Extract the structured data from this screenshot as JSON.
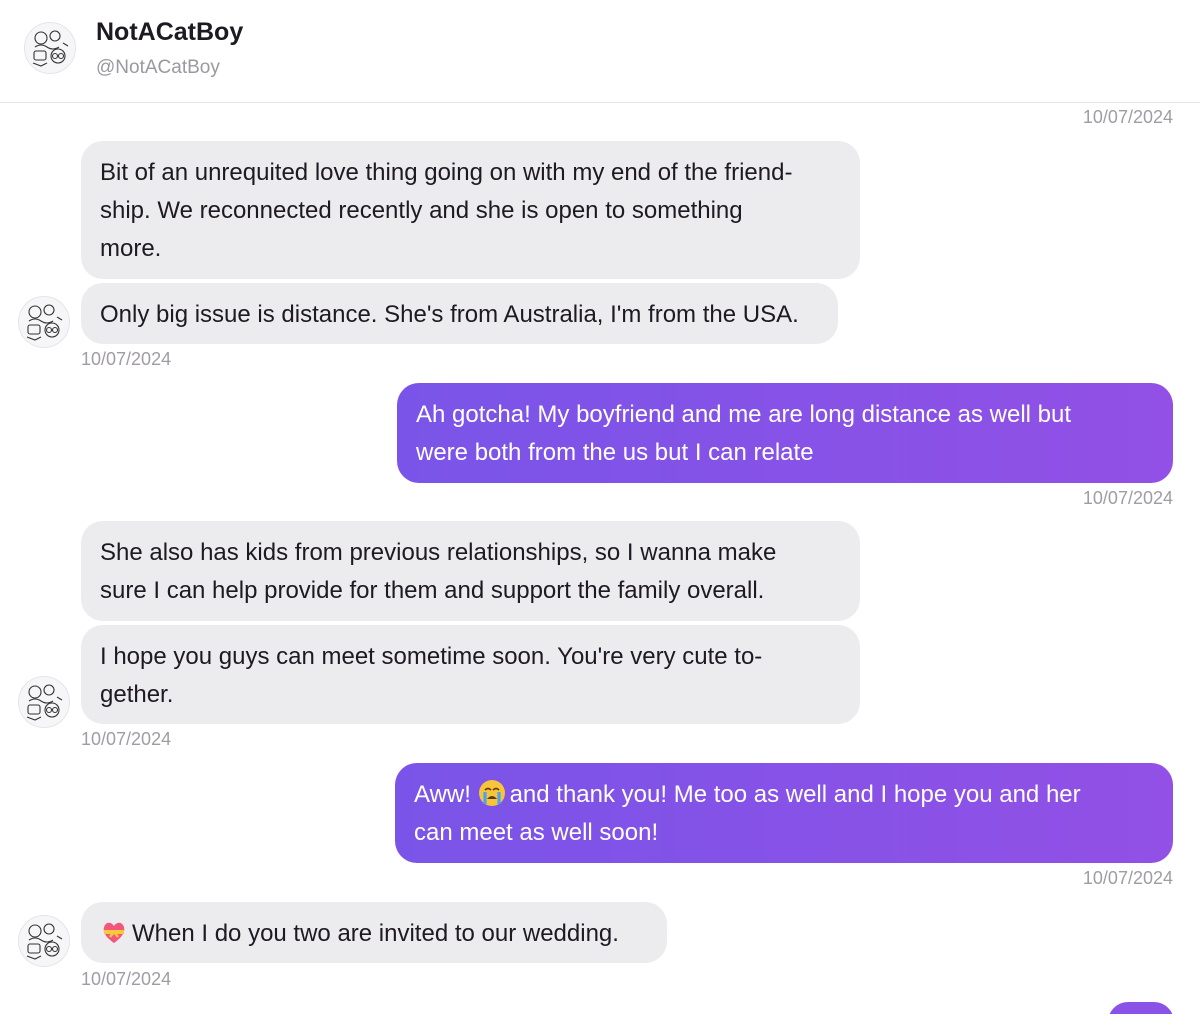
{
  "header": {
    "name": "NotACatBoy",
    "handle": "@NotACatBoy"
  },
  "messages": {
    "m1_time": "10/07/2024",
    "m1_a": "Bit of an unrequited love thing going on with my end of the friend-ship. We reconnected recently and she is open to something more.",
    "m1_a_lines": [
      "Bit of an unrequited love thing going on with my end of the friend-",
      "ship. We reconnected recently and she is open to something",
      "more."
    ],
    "m1_b": "Only big issue is distance. She's from Australia, I'm from the USA.",
    "m1_stamp": "10/07/2024",
    "m2_lines": [
      "Ah gotcha! My boyfriend and me are long distance as well but",
      "were both from the us but I can relate"
    ],
    "m2_stamp": "10/07/2024",
    "m3_a_lines": [
      "She also has kids from previous relationships, so I wanna make",
      "sure I can help provide for them and support the family overall."
    ],
    "m3_b_lines": [
      "I hope you guys can meet sometime soon. You're very cute to-",
      "gether."
    ],
    "m3_stamp": "10/07/2024",
    "m4_pre": "Aww! ",
    "m4_emoji": "loudly-crying-face-icon",
    "m4_post": "and thank you! Me too as well and I hope you and her",
    "m4_line2": "can meet as well soon!",
    "m4_stamp": "10/07/2024",
    "m5_emoji": "heart-with-ribbon-icon",
    "m5_text": "When I do you two are invited to our wedding.",
    "m5_stamp": "10/07/2024"
  },
  "colors": {
    "incoming_bubble": "#ecebee",
    "outgoing_bubble_start": "#7a54e8",
    "outgoing_bubble_end": "#9250e6",
    "timestamp": "#a09ca5"
  }
}
